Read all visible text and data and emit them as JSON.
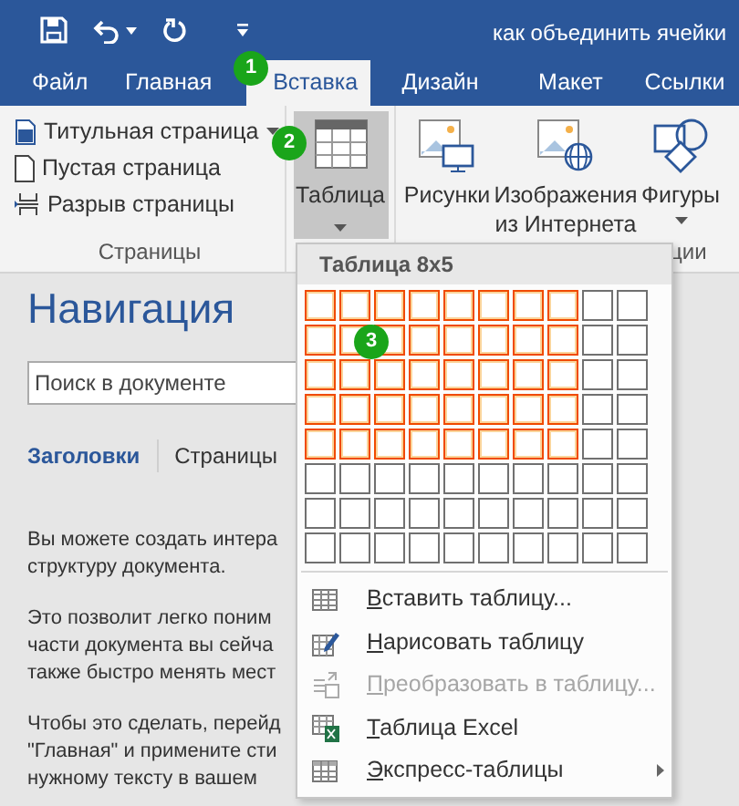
{
  "window": {
    "title": "как объединить ячейки"
  },
  "tabs": [
    {
      "label": "Файл",
      "selected": false
    },
    {
      "label": "Главная",
      "selected": false
    },
    {
      "label": "Вставка",
      "selected": true
    },
    {
      "label": "Дизайн",
      "selected": false
    },
    {
      "label": "Макет",
      "selected": false
    },
    {
      "label": "Ссылки",
      "selected": false
    }
  ],
  "ribbon": {
    "pages_group": {
      "items": [
        {
          "label": "Титульная страница",
          "dropdown": true
        },
        {
          "label": "Пустая страница",
          "dropdown": false
        },
        {
          "label": "Разрыв страницы",
          "dropdown": false
        }
      ],
      "label": "Страницы"
    },
    "table_button": {
      "label": "Таблица",
      "selected": true
    },
    "illustrations": [
      {
        "label": "Рисунки",
        "dropdown": false
      },
      {
        "label": "Изображения из Интернета",
        "dropdown": false
      },
      {
        "label": "Фигуры",
        "dropdown": true
      }
    ],
    "illustrations_label": "ции"
  },
  "navigation": {
    "title": "Навигация",
    "search": {
      "placeholder": "Поиск в документе"
    },
    "tabs": [
      {
        "label": "Заголовки",
        "selected": true
      },
      {
        "label": "Страницы",
        "selected": false
      }
    ],
    "paragraphs": [
      {
        "lines": [
          "Вы можете создать интера",
          "структуру документа."
        ]
      },
      {
        "lines": [
          "Это позволит легко поним",
          "части документа вы сейча",
          "также быстро менять мест"
        ]
      },
      {
        "lines": [
          "Чтобы это сделать, перейд",
          "\"Главная\" и примените сти",
          "нужному тексту в вашем"
        ]
      }
    ]
  },
  "table_menu": {
    "title": "Таблица 8x5",
    "grid": [
      {
        "cells": [
          {
            "selected": true
          },
          {
            "selected": true
          },
          {
            "selected": true
          },
          {
            "selected": true
          },
          {
            "selected": true
          },
          {
            "selected": true
          },
          {
            "selected": true
          },
          {
            "selected": true
          },
          {
            "selected": false
          },
          {
            "selected": false
          }
        ]
      },
      {
        "cells": [
          {
            "selected": true
          },
          {
            "selected": true
          },
          {
            "selected": true
          },
          {
            "selected": true
          },
          {
            "selected": true
          },
          {
            "selected": true
          },
          {
            "selected": true
          },
          {
            "selected": true
          },
          {
            "selected": false
          },
          {
            "selected": false
          }
        ]
      },
      {
        "cells": [
          {
            "selected": true
          },
          {
            "selected": true
          },
          {
            "selected": true
          },
          {
            "selected": true
          },
          {
            "selected": true
          },
          {
            "selected": true
          },
          {
            "selected": true
          },
          {
            "selected": true
          },
          {
            "selected": false
          },
          {
            "selected": false
          }
        ]
      },
      {
        "cells": [
          {
            "selected": true
          },
          {
            "selected": true
          },
          {
            "selected": true
          },
          {
            "selected": true
          },
          {
            "selected": true
          },
          {
            "selected": true
          },
          {
            "selected": true
          },
          {
            "selected": true
          },
          {
            "selected": false
          },
          {
            "selected": false
          }
        ]
      },
      {
        "cells": [
          {
            "selected": true
          },
          {
            "selected": true
          },
          {
            "selected": true
          },
          {
            "selected": true
          },
          {
            "selected": true
          },
          {
            "selected": true
          },
          {
            "selected": true
          },
          {
            "selected": true
          },
          {
            "selected": false
          },
          {
            "selected": false
          }
        ]
      },
      {
        "cells": [
          {
            "selected": false
          },
          {
            "selected": false
          },
          {
            "selected": false
          },
          {
            "selected": false
          },
          {
            "selected": false
          },
          {
            "selected": false
          },
          {
            "selected": false
          },
          {
            "selected": false
          },
          {
            "selected": false
          },
          {
            "selected": false
          }
        ]
      },
      {
        "cells": [
          {
            "selected": false
          },
          {
            "selected": false
          },
          {
            "selected": false
          },
          {
            "selected": false
          },
          {
            "selected": false
          },
          {
            "selected": false
          },
          {
            "selected": false
          },
          {
            "selected": false
          },
          {
            "selected": false
          },
          {
            "selected": false
          }
        ]
      },
      {
        "cells": [
          {
            "selected": false
          },
          {
            "selected": false
          },
          {
            "selected": false
          },
          {
            "selected": false
          },
          {
            "selected": false
          },
          {
            "selected": false
          },
          {
            "selected": false
          },
          {
            "selected": false
          },
          {
            "selected": false
          },
          {
            "selected": false
          }
        ]
      }
    ],
    "items": [
      {
        "kind": "insert",
        "label": "Вставить таблицу...",
        "disabled": false,
        "submenu": false
      },
      {
        "kind": "draw",
        "label": "Нарисовать таблицу",
        "disabled": false,
        "submenu": false
      },
      {
        "kind": "convert",
        "label": "Преобразовать в таблицу...",
        "disabled": true,
        "submenu": false
      },
      {
        "kind": "excel",
        "label": "Таблица Excel",
        "disabled": false,
        "submenu": false
      },
      {
        "kind": "quick",
        "label": "Экспресс-таблицы",
        "disabled": false,
        "submenu": true
      }
    ]
  },
  "step_markers": [
    "1",
    "2",
    "3"
  ]
}
